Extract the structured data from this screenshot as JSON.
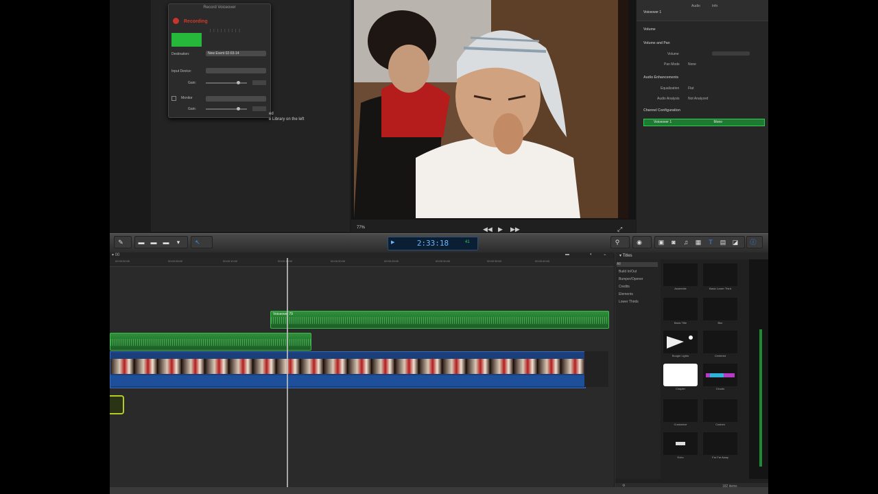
{
  "voice_over": {
    "title": "Record Voiceover",
    "record_label": "Recording",
    "destination_label": "Destination:",
    "destination_value": "New Event 02-03-14",
    "input_device_label": "Input Device:",
    "gain_label": "Gain:",
    "monitor_label": "Monitor",
    "monitor_gain_label": "Gain:"
  },
  "side_text": {
    "line1": "ed",
    "line2": "e Library on the left"
  },
  "timeline": {
    "index_label": "▾ 00",
    "ruler_ticks": [
      "00:00:00:00",
      "00:00:05:00",
      "00:00:10:00",
      "00:00:15:00",
      "00:00:20:00",
      "00:00:25:00",
      "00:00:30:00",
      "00:00:35:00",
      "00:00:40:00"
    ],
    "audio_clip_name": "Voiceover 79",
    "frame_count": 20
  },
  "toolbar": {
    "timecode": "2:33:18",
    "timecode_badge": "41"
  },
  "browser": {
    "header": "▾ Titles",
    "categories": [
      "All",
      "Build In/Out",
      "Bumper/Opener",
      "Credits",
      "Elements",
      "Lower Thirds"
    ],
    "tiles": [
      "Assemble",
      "Basic Lower Third",
      "Basic Title",
      "Blur",
      "Boogie Lights",
      "Centered",
      "Chapter",
      "Clouds",
      "Customize",
      "Custom",
      "Echo",
      "Far Far Away",
      "Expand",
      "Drifting"
    ],
    "footer_count": "182 items"
  },
  "inspector": {
    "title": "Voiceover 1",
    "tabs": [
      "Audio",
      "Info"
    ],
    "sections": [
      "Volume",
      "Volume and Pan",
      "Audio Enhancements",
      "Channel Configuration"
    ],
    "rows": [
      "Volume",
      "Pan Mode",
      "Equalization",
      "Audio Analysis"
    ],
    "pan_mode_value": "None",
    "eq_value": "Flat",
    "analysis_value": "Not Analyzed",
    "channel_label": "Voiceover 1",
    "channel_value": "Mono"
  },
  "viewer": {
    "zoom": "77%"
  },
  "colors": {
    "accent_green": "#2bd14a",
    "record_red": "#d23a2a",
    "timecode_blue": "#6fb6ff",
    "video_clip_blue": "#1b3f7a"
  }
}
